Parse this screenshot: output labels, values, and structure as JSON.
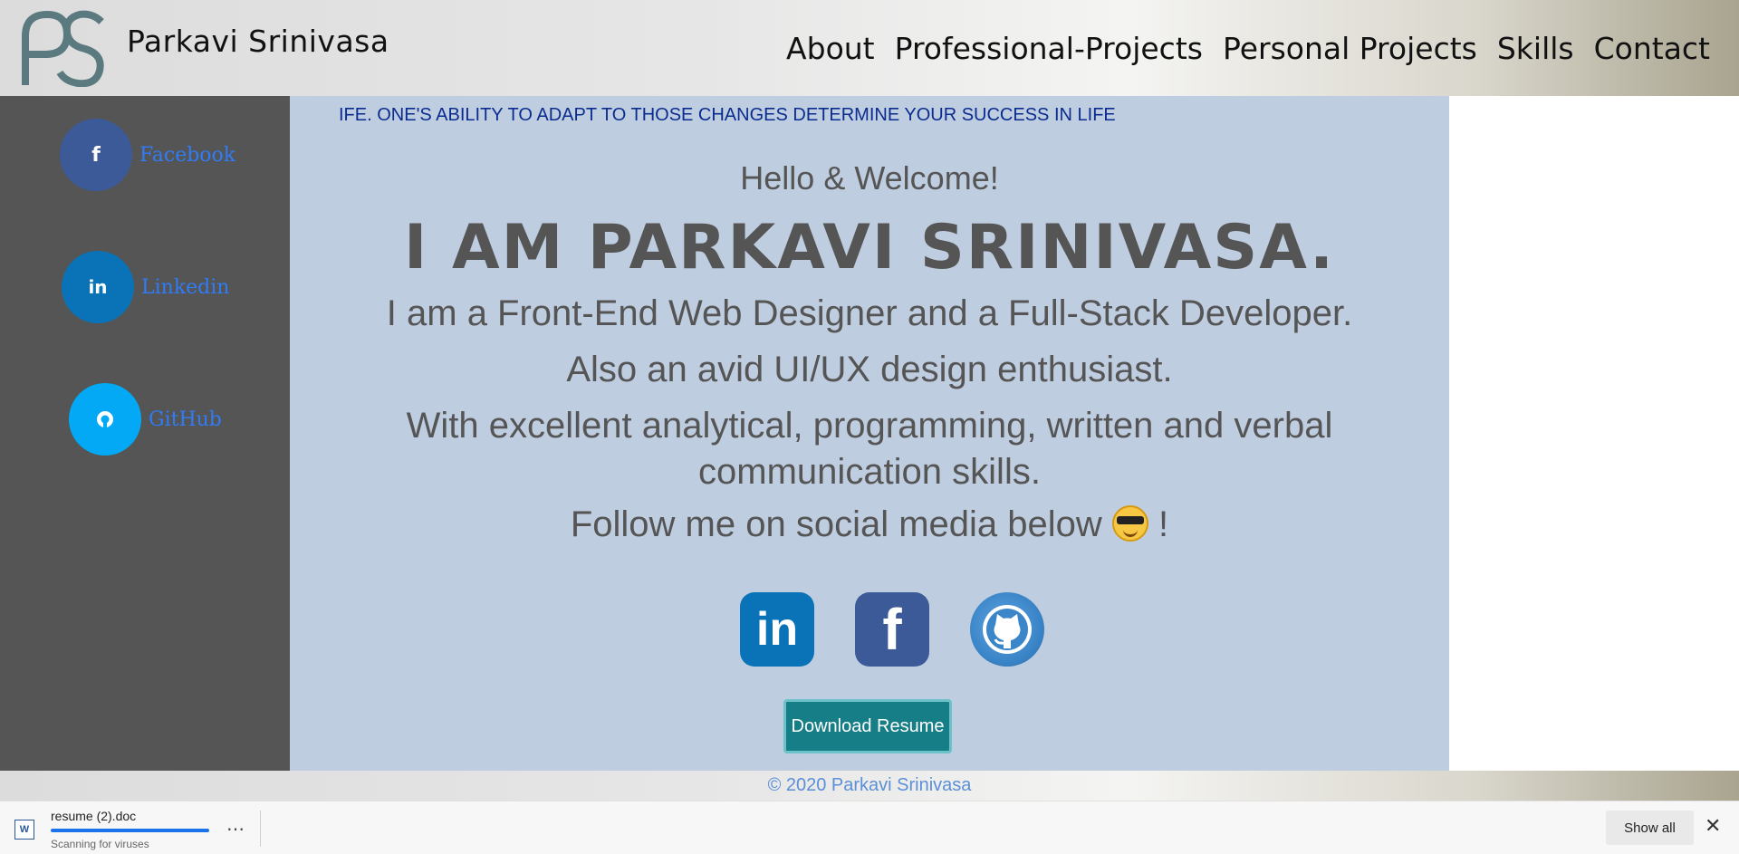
{
  "header": {
    "site_name": "Parkavi Srinivasa",
    "logo_text": "PS",
    "nav": [
      "About",
      "Professional-Projects",
      "Personal Projects",
      "Skills",
      "Contact"
    ]
  },
  "sidebar": {
    "items": [
      {
        "label": "Facebook",
        "icon": "facebook-icon",
        "color": "#3d5a98"
      },
      {
        "label": "Linkedin",
        "icon": "linkedin-icon",
        "color": "#0a73b7"
      },
      {
        "label": "GitHub",
        "icon": "github-icon",
        "color": "#03a9f4"
      }
    ]
  },
  "main": {
    "marquee": "IFE. ONE'S ABILITY TO ADAPT TO THOSE CHANGES DETERMINE YOUR SUCCESS IN LIFE",
    "hello": "Hello & Welcome!",
    "headline": "I AM PARKAVI SRINIVASA.",
    "line1": "I am a Front-End Web Designer and a Full-Stack Developer.",
    "line2": "Also an avid UI/UX design enthusiast.",
    "line3a": "With excellent analytical, programming, written and verbal",
    "line3b": "communication skills.",
    "follow": "Follow me on social media below",
    "follow_end": "!",
    "download_button": "Download Resume"
  },
  "footer": {
    "copyright": "© 2020 Parkavi Srinivasa"
  },
  "download_bar": {
    "file_name": "resume (2).doc",
    "status": "Scanning for viruses",
    "show_all": "Show all",
    "more": "⋯",
    "close": "✕"
  },
  "colors": {
    "main_bg": "#bfcde0",
    "sidebar_bg": "#555555",
    "accent_button": "#167e86"
  }
}
